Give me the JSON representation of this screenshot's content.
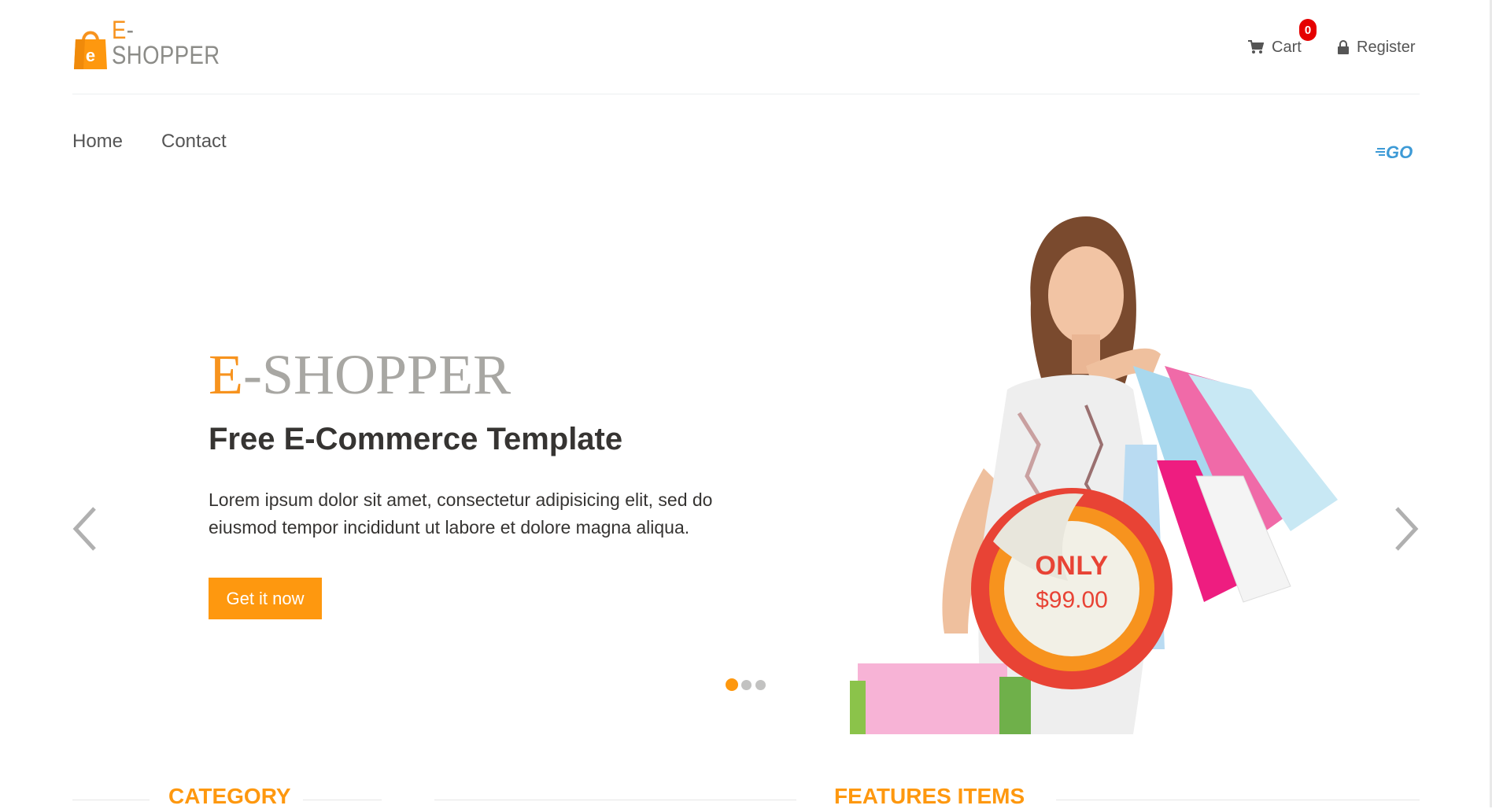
{
  "header": {
    "logo": {
      "prefix": "E",
      "rest": "-SHOPPER",
      "bag_letter": "e"
    },
    "cart_label": "Cart",
    "cart_count": "0",
    "register_label": "Register"
  },
  "nav": {
    "items": [
      {
        "label": "Home"
      },
      {
        "label": "Contact"
      }
    ],
    "brand_badge": "GO"
  },
  "hero": {
    "title_prefix": "E",
    "title_rest": "-SHOPPER",
    "subtitle": "Free E-Commerce Template",
    "description": "Lorem ipsum dolor sit amet, consectetur adipisicing elit, sed do eiusmod tempor incididunt ut labore et dolore magna aliqua.",
    "cta_label": "Get it now",
    "price_tag": {
      "label": "ONLY",
      "price": "$99.00"
    },
    "active_slide": 1,
    "slide_count": 3
  },
  "sections": {
    "category_title": "CATEGORY",
    "features_title": "FEATURES ITEMS"
  },
  "colors": {
    "accent": "#fe980f",
    "badge": "#e50000",
    "price_tag": "#e84335",
    "text_dark": "#363432",
    "logo_gray": "#8c8c88"
  }
}
